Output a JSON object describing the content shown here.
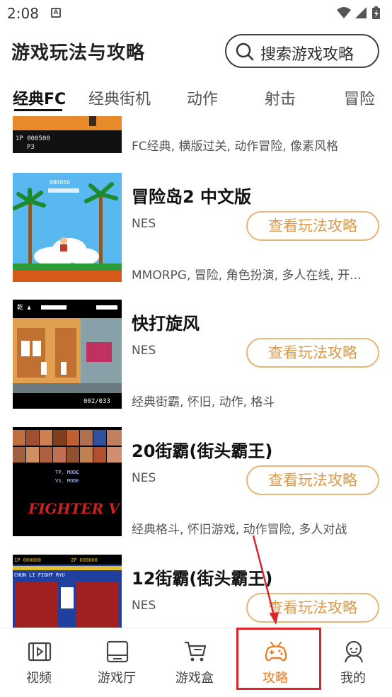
{
  "status_bar": {
    "time": "2:08",
    "notification_letter": "A"
  },
  "header": {
    "title": "游戏玩法与攻略",
    "search_placeholder": "搜索游戏攻略"
  },
  "tabs": [
    {
      "label": "经典FC",
      "active": true
    },
    {
      "label": "经典街机",
      "active": false
    },
    {
      "label": "动作",
      "active": false
    },
    {
      "label": "射击",
      "active": false
    },
    {
      "label": "冒险",
      "active": false
    }
  ],
  "partial_item": {
    "tags": "FC经典, 横版过关, 动作冒险, 像素风格",
    "thumb_text_1": "1P 000500",
    "thumb_text_2": "P3"
  },
  "games": [
    {
      "title": "冒险岛2 中文版",
      "platform": "NES",
      "button": "查看玩法攻略",
      "tags": "MMORPG, 冒险, 角色扮演, 多人在线, 开...",
      "thumb_score": "000050"
    },
    {
      "title": "快打旋风",
      "platform": "NES",
      "button": "查看玩法攻略",
      "tags": "经典街霸, 怀旧, 动作, 格斗",
      "thumb_hud_left": "乾 ♟",
      "thumb_hud_right": "002/033"
    },
    {
      "title": "20街霸(街头霸王)",
      "platform": "NES",
      "button": "查看玩法攻略",
      "tags": "经典格斗, 怀旧游戏, 动作冒险, 多人对战",
      "thumb_menu_1": "TP. MODE",
      "thumb_menu_2": "VS. MODE",
      "thumb_logo": "FIGHTER V"
    },
    {
      "title": "12街霸(街头霸王)",
      "platform": "NES",
      "button": "查看玩法攻略",
      "tags": "",
      "thumb_hud_1": "2P 000000",
      "thumb_hud_2": "1P 000000",
      "thumb_names": "CHUN LI  FIGHT  RYU"
    }
  ],
  "bottom_nav": [
    {
      "label": "视频",
      "icon": "film-icon",
      "active": false
    },
    {
      "label": "游戏厅",
      "icon": "arcade-icon",
      "active": false
    },
    {
      "label": "游戏盒",
      "icon": "cart-icon",
      "active": false
    },
    {
      "label": "攻略",
      "icon": "gamepad-icon",
      "active": true
    },
    {
      "label": "我的",
      "icon": "profile-icon",
      "active": false
    }
  ],
  "colors": {
    "accent": "#f07a1a",
    "button_border": "#e8b674",
    "button_text": "#d99a4a",
    "highlight": "#d9262b"
  }
}
